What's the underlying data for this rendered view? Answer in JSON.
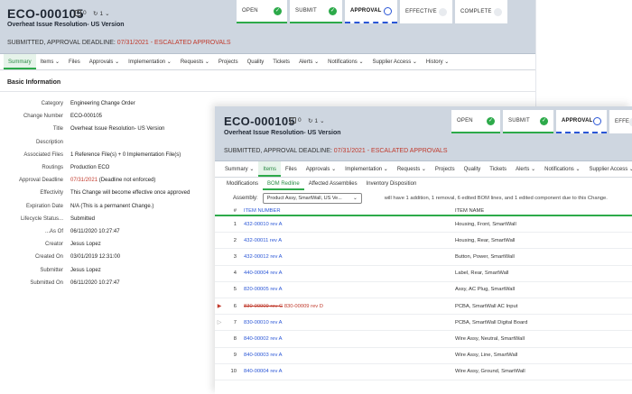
{
  "eco": {
    "id": "ECO-000105",
    "title": "Overheat Issue Resolution- US Version",
    "attachments_count": "0",
    "revisions_count": "1",
    "status_prefix": "SUBMITTED, APPROVAL DEADLINE: ",
    "deadline": "07/31/2021",
    "status_suffix": " - ESCALATED APPROVALS"
  },
  "workflow": [
    {
      "label": "OPEN",
      "state": "done"
    },
    {
      "label": "SUBMIT",
      "state": "done"
    },
    {
      "label": "APPROVAL",
      "state": "current"
    },
    {
      "label": "EFFECTIVE",
      "state": "todo"
    },
    {
      "label": "COMPLETE",
      "state": "todo"
    }
  ],
  "front_workflow": [
    {
      "label": "OPEN",
      "state": "done"
    },
    {
      "label": "SUBMIT",
      "state": "done"
    },
    {
      "label": "APPROVAL",
      "state": "current"
    },
    {
      "label": "EFFE",
      "state": "todo"
    }
  ],
  "tabs_back": [
    "Summary",
    "Items",
    "Files",
    "Approvals",
    "Implementation",
    "Requests",
    "Projects",
    "Quality",
    "Tickets",
    "Alerts",
    "Notifications",
    "Supplier Access",
    "History"
  ],
  "tabs_front": [
    "Summary",
    "Items",
    "Files",
    "Approvals",
    "Implementation",
    "Requests",
    "Projects",
    "Quality",
    "Tickets",
    "Alerts",
    "Notifications",
    "Supplier Access"
  ],
  "subtabs": [
    "Modifications",
    "BOM Redline",
    "Affected Assemblies",
    "Inventory Disposition"
  ],
  "basic_info": {
    "title": "Basic Information",
    "fields": [
      {
        "k": "Category",
        "v": "Engineering Change Order"
      },
      {
        "k": "Change Number",
        "v": "ECO-000105"
      },
      {
        "k": "Title",
        "v": "Overheat Issue Resolution- US Version"
      },
      {
        "k": "Description",
        "v": ""
      },
      {
        "k": "Associated Files",
        "v": "1 Reference File(s) + 0 Implementation File(s)"
      },
      {
        "k": "Routings",
        "v": "Production ECO"
      },
      {
        "k": "Approval Deadline",
        "v_red": "07/31/2021",
        "v": " (Deadline not enforced)"
      },
      {
        "k": "Effectivity",
        "v": "This Change will become effective once approved"
      },
      {
        "k": "Expiration Date",
        "v": "N/A (This is a permanent Change.)"
      },
      {
        "k": "Lifecycle Status...",
        "v": "Submitted"
      },
      {
        "k": "...As Of",
        "v": "06/11/2020 10:27:47"
      },
      {
        "k": "Creator",
        "v": "Jesus Lopez"
      },
      {
        "k": "Created On",
        "v": "03/01/2019 12:31:00"
      },
      {
        "k": "Submitter",
        "v": "Jesus Lopez"
      },
      {
        "k": "Submitted On",
        "v": "06/11/2020 10:27:47"
      }
    ]
  },
  "assembly": {
    "label": "Assembly:",
    "selected": "Product Assy, SmartWall, US Ve...",
    "message": "will have 1 addition, 1 removal, 6 edited BOM lines, and 1 edited component due to this Change."
  },
  "bom": {
    "headers": {
      "num": "#",
      "item": "ITEM NUMBER",
      "name": "ITEM NAME"
    },
    "rows": [
      {
        "n": "1",
        "item": "432-00010 rev A",
        "name": "Housing, Front, SmartWall"
      },
      {
        "n": "2",
        "item": "432-00011 rev A",
        "name": "Housing, Rear, SmartWall"
      },
      {
        "n": "3",
        "item": "432-00012 rev A",
        "name": "Button, Power, SmartWall"
      },
      {
        "n": "4",
        "item": "440-00004 rev A",
        "name": "Label, Rear, SmartWall"
      },
      {
        "n": "5",
        "item": "820-00005 rev A",
        "name": "Assy, AC Plug, SmartWall"
      },
      {
        "n": "6",
        "item_strike": "830-00009 rev C",
        "item_new": "830-00009 rev D",
        "name": "PCBA, SmartWall AC Input",
        "flag": "red"
      },
      {
        "n": "7",
        "item": "830-00010 rev A",
        "name": "PCBA, SmartWall Digital Board",
        "flag": "grey"
      },
      {
        "n": "8",
        "item": "840-00002 rev A",
        "name": "Wire Assy, Neutral, SmartWall"
      },
      {
        "n": "9",
        "item": "840-00003 rev A",
        "name": "Wire Assy, Line, SmartWall"
      },
      {
        "n": "10",
        "item": "840-00004 rev A",
        "name": "Wire Assy, Ground, SmartWall"
      }
    ]
  },
  "colors": {
    "accent_green": "#2daa4a",
    "accent_blue": "#2a56d6",
    "alert_red": "#c0392b",
    "header_bg": "#ced6e0"
  }
}
